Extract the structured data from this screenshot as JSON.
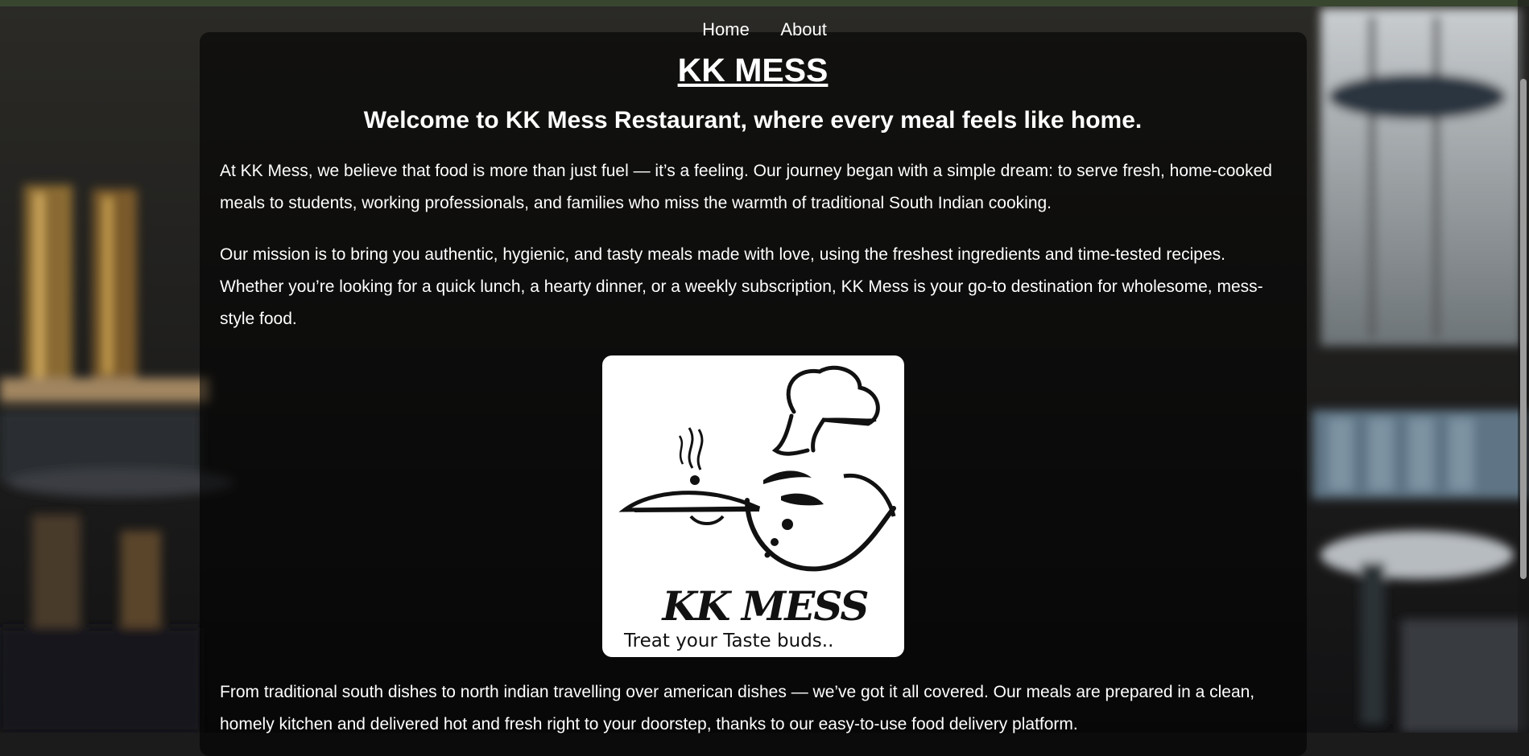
{
  "nav": {
    "home": "Home",
    "about": "About"
  },
  "header": {
    "title": "KK MESS",
    "tagline": "Welcome to KK Mess Restaurant, where every meal feels like home."
  },
  "content": {
    "paragraph_1": "At KK Mess, we believe that food is more than just fuel — it’s a feeling. Our journey began with a simple dream: to serve fresh, home-cooked meals to students, working professionals, and families who miss the warmth of traditional South Indian cooking.",
    "paragraph_2": "Our mission is to bring you authentic, hygienic, and tasty meals made with love, using the freshest ingredients and time-tested recipes. Whether you’re looking for a quick lunch, a hearty dinner, or a weekly subscription, KK Mess is your go-to destination for wholesome, mess-style food.",
    "paragraph_3": "From traditional south dishes to north indian travelling over american dishes — we’ve got it all covered. Our meals are prepared in a clean, homely kitchen and delivered hot and fresh right to your doorstep, thanks to our easy-to-use food delivery platform."
  },
  "logo": {
    "wordmark": "KK MESS",
    "tagline": "Treat your Taste buds.."
  },
  "colors": {
    "text": "#ffffff",
    "panel_overlay": "rgba(0,0,0,0.58)",
    "top_bar": "#39462f"
  }
}
